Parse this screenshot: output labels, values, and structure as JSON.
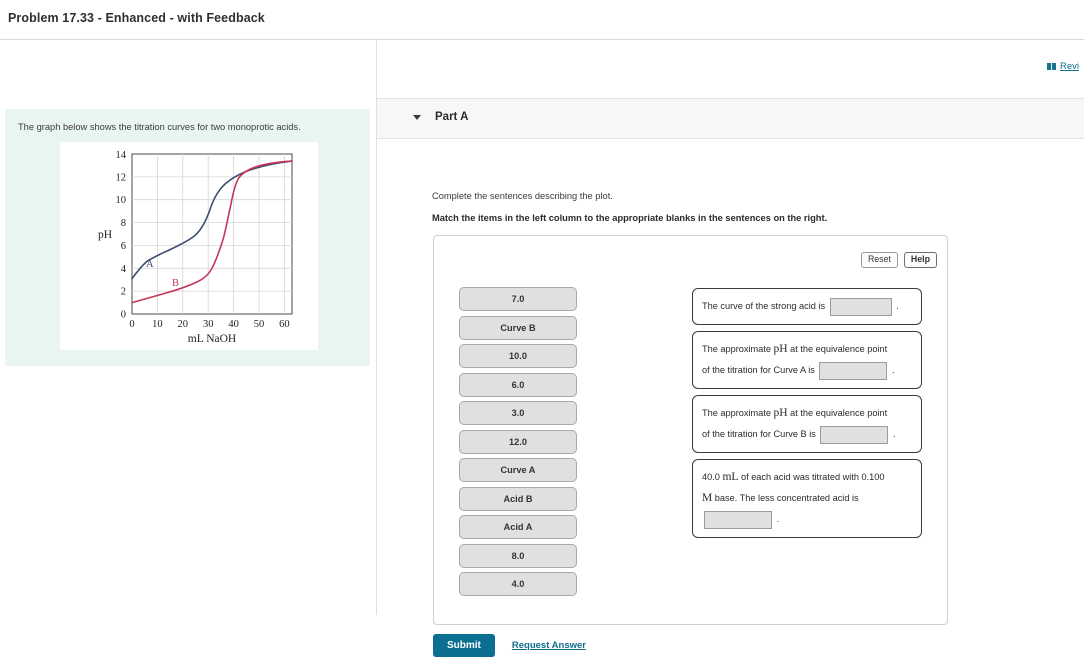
{
  "window": {
    "title": "Problem 17.33 - Enhanced - with Feedback"
  },
  "header": {
    "review_label": "Revi",
    "review_icon": "book-icon"
  },
  "left": {
    "question_text": "The graph below shows the titration curves for two monoprotic acids."
  },
  "part": {
    "label": "Part A",
    "caret_icon": "chevron-down-icon",
    "instruction_1": "Complete the sentences describing the plot.",
    "instruction_2": "Match the items in the left column to the appropriate blanks in the sentences on the right."
  },
  "tools": {
    "reset_label": "Reset",
    "help_label": "Help"
  },
  "tokens": [
    {
      "label": "7.0"
    },
    {
      "label": "Curve B"
    },
    {
      "label": "10.0"
    },
    {
      "label": "6.0"
    },
    {
      "label": "3.0"
    },
    {
      "label": "12.0"
    },
    {
      "label": "Curve A"
    },
    {
      "label": "Acid B"
    },
    {
      "label": "Acid A"
    },
    {
      "label": "8.0"
    },
    {
      "label": "4.0"
    }
  ],
  "sentences": [
    {
      "id": "strong-acid-curve",
      "line1_pre": "The curve of the strong acid is",
      "line1_post": ".",
      "blank_after_line1": true
    },
    {
      "id": "equivalence-ph-curve-a",
      "line1_a": "The approximate ",
      "line1_math": "pH",
      "line1_b": " at the equivalence point",
      "line2_pre": "of the titration for Curve A is",
      "line2_post": "."
    },
    {
      "id": "equivalence-ph-curve-b",
      "line1_a": "The approximate ",
      "line1_math": "pH",
      "line1_b": " at the equivalence point",
      "line2_pre": "of the titration for Curve B is",
      "line2_post": "."
    },
    {
      "id": "less-concentrated-acid",
      "line1_a": "40.0 ",
      "line1_math": "mL",
      "line1_b": " of each acid was titrated with 0.100",
      "line2_math": "M",
      "line2_b": " base. The less concentrated acid is",
      "line3_post": "."
    }
  ],
  "footer": {
    "submit_label": "Submit",
    "request_answer_label": "Request Answer"
  },
  "colors": {
    "curve_a": "#3c4c6e",
    "curve_b": "#c43656",
    "accent": "#0a6f91",
    "panel_bg": "#e9f5f3",
    "token_bg": "#e0e0e0"
  },
  "chart_data": {
    "type": "line",
    "title": "",
    "xlabel": "mL NaOH",
    "ylabel": "pH",
    "xlim": [
      0,
      63
    ],
    "ylim": [
      0,
      14
    ],
    "xticks": [
      0,
      10,
      20,
      30,
      40,
      50,
      60
    ],
    "yticks": [
      0,
      2,
      4,
      6,
      8,
      10,
      12,
      14
    ],
    "grid": true,
    "legend": "inline-annotations",
    "annotations": [
      {
        "text": "A",
        "x": 5,
        "y": 4.6,
        "color": "#3c4c6e"
      },
      {
        "text": "B",
        "x": 17,
        "y": 2.6,
        "color": "#c43656"
      }
    ],
    "series": [
      {
        "name": "A",
        "label": "A",
        "color": "#3c4c6e",
        "equivalence_volume_mL": 30,
        "equivalence_pH": 8.0,
        "initial_pH": 3.1,
        "final_pH": 12.4,
        "x": [
          0,
          2,
          5,
          8,
          11,
          14,
          17,
          20,
          23,
          25,
          27,
          28,
          29,
          29.5,
          30,
          30.5,
          31,
          32,
          33,
          35,
          38,
          42,
          46,
          50,
          55,
          60,
          63
        ],
        "y": [
          3.1,
          3.6,
          4.1,
          4.4,
          4.65,
          4.85,
          5.05,
          5.25,
          5.5,
          5.7,
          6.0,
          6.3,
          6.8,
          7.4,
          8.0,
          8.9,
          9.6,
          10.3,
          10.7,
          11.1,
          11.5,
          11.8,
          12.0,
          12.15,
          12.3,
          12.4,
          12.45
        ]
      },
      {
        "name": "B",
        "label": "B",
        "color": "#c43656",
        "equivalence_volume_mL": 40,
        "equivalence_pH": 7.0,
        "initial_pH": 1.0,
        "final_pH": 12.4,
        "x": [
          0,
          3,
          6,
          10,
          14,
          18,
          22,
          26,
          30,
          33,
          35,
          37,
          38,
          39,
          39.5,
          40,
          40.5,
          41,
          42,
          43,
          45,
          48,
          52,
          56,
          60,
          63
        ],
        "y": [
          1.0,
          1.15,
          1.3,
          1.5,
          1.7,
          1.9,
          2.1,
          2.35,
          2.65,
          2.95,
          3.2,
          3.6,
          3.95,
          4.8,
          5.8,
          7.0,
          8.4,
          9.6,
          10.6,
          11.1,
          11.55,
          11.9,
          12.1,
          12.25,
          12.38,
          12.45
        ]
      }
    ]
  }
}
